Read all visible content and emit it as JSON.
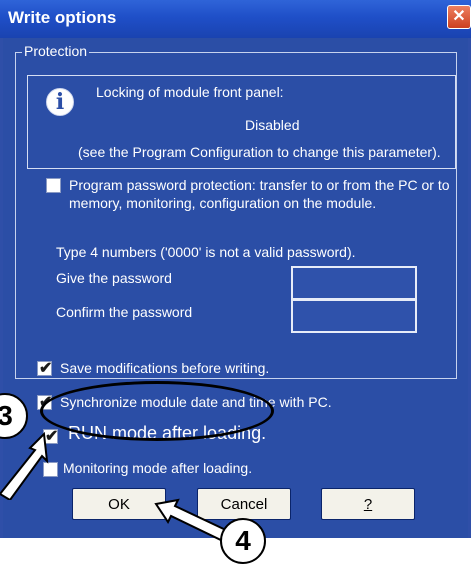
{
  "window": {
    "title": "Write options",
    "close_symbol": "✕"
  },
  "protection": {
    "legend": "Protection",
    "info_icon_glyph": "i",
    "lock_title": "Locking of module front panel:",
    "lock_status": "Disabled",
    "lock_note": "(see the Program Configuration to change this parameter).",
    "password_protection": {
      "checked": false,
      "label_line1": "Program password protection: transfer to or from the PC or to",
      "label_line2": "memory, monitoring, configuration on the module."
    },
    "password_hint": "Type 4 numbers ('0000' is not a valid password).",
    "give_password_label": "Give the password",
    "give_password_value": "",
    "confirm_password_label": "Confirm the password",
    "confirm_password_value": ""
  },
  "options": [
    {
      "label": "Save modifications before writing.",
      "checked": true
    },
    {
      "label": "Synchronize module date and time with PC.",
      "checked": true
    },
    {
      "label": "RUN mode after loading.",
      "checked": true
    },
    {
      "label": "Monitoring mode after loading.",
      "checked": false
    }
  ],
  "buttons": {
    "ok": "OK",
    "cancel": "Cancel",
    "help": "?"
  },
  "callouts": {
    "badge3": "3",
    "badge4": "4"
  },
  "colors": {
    "dialog_background": "#2b4ea6",
    "titlebar": "#1f4fc8",
    "close_button": "#d9532f"
  }
}
